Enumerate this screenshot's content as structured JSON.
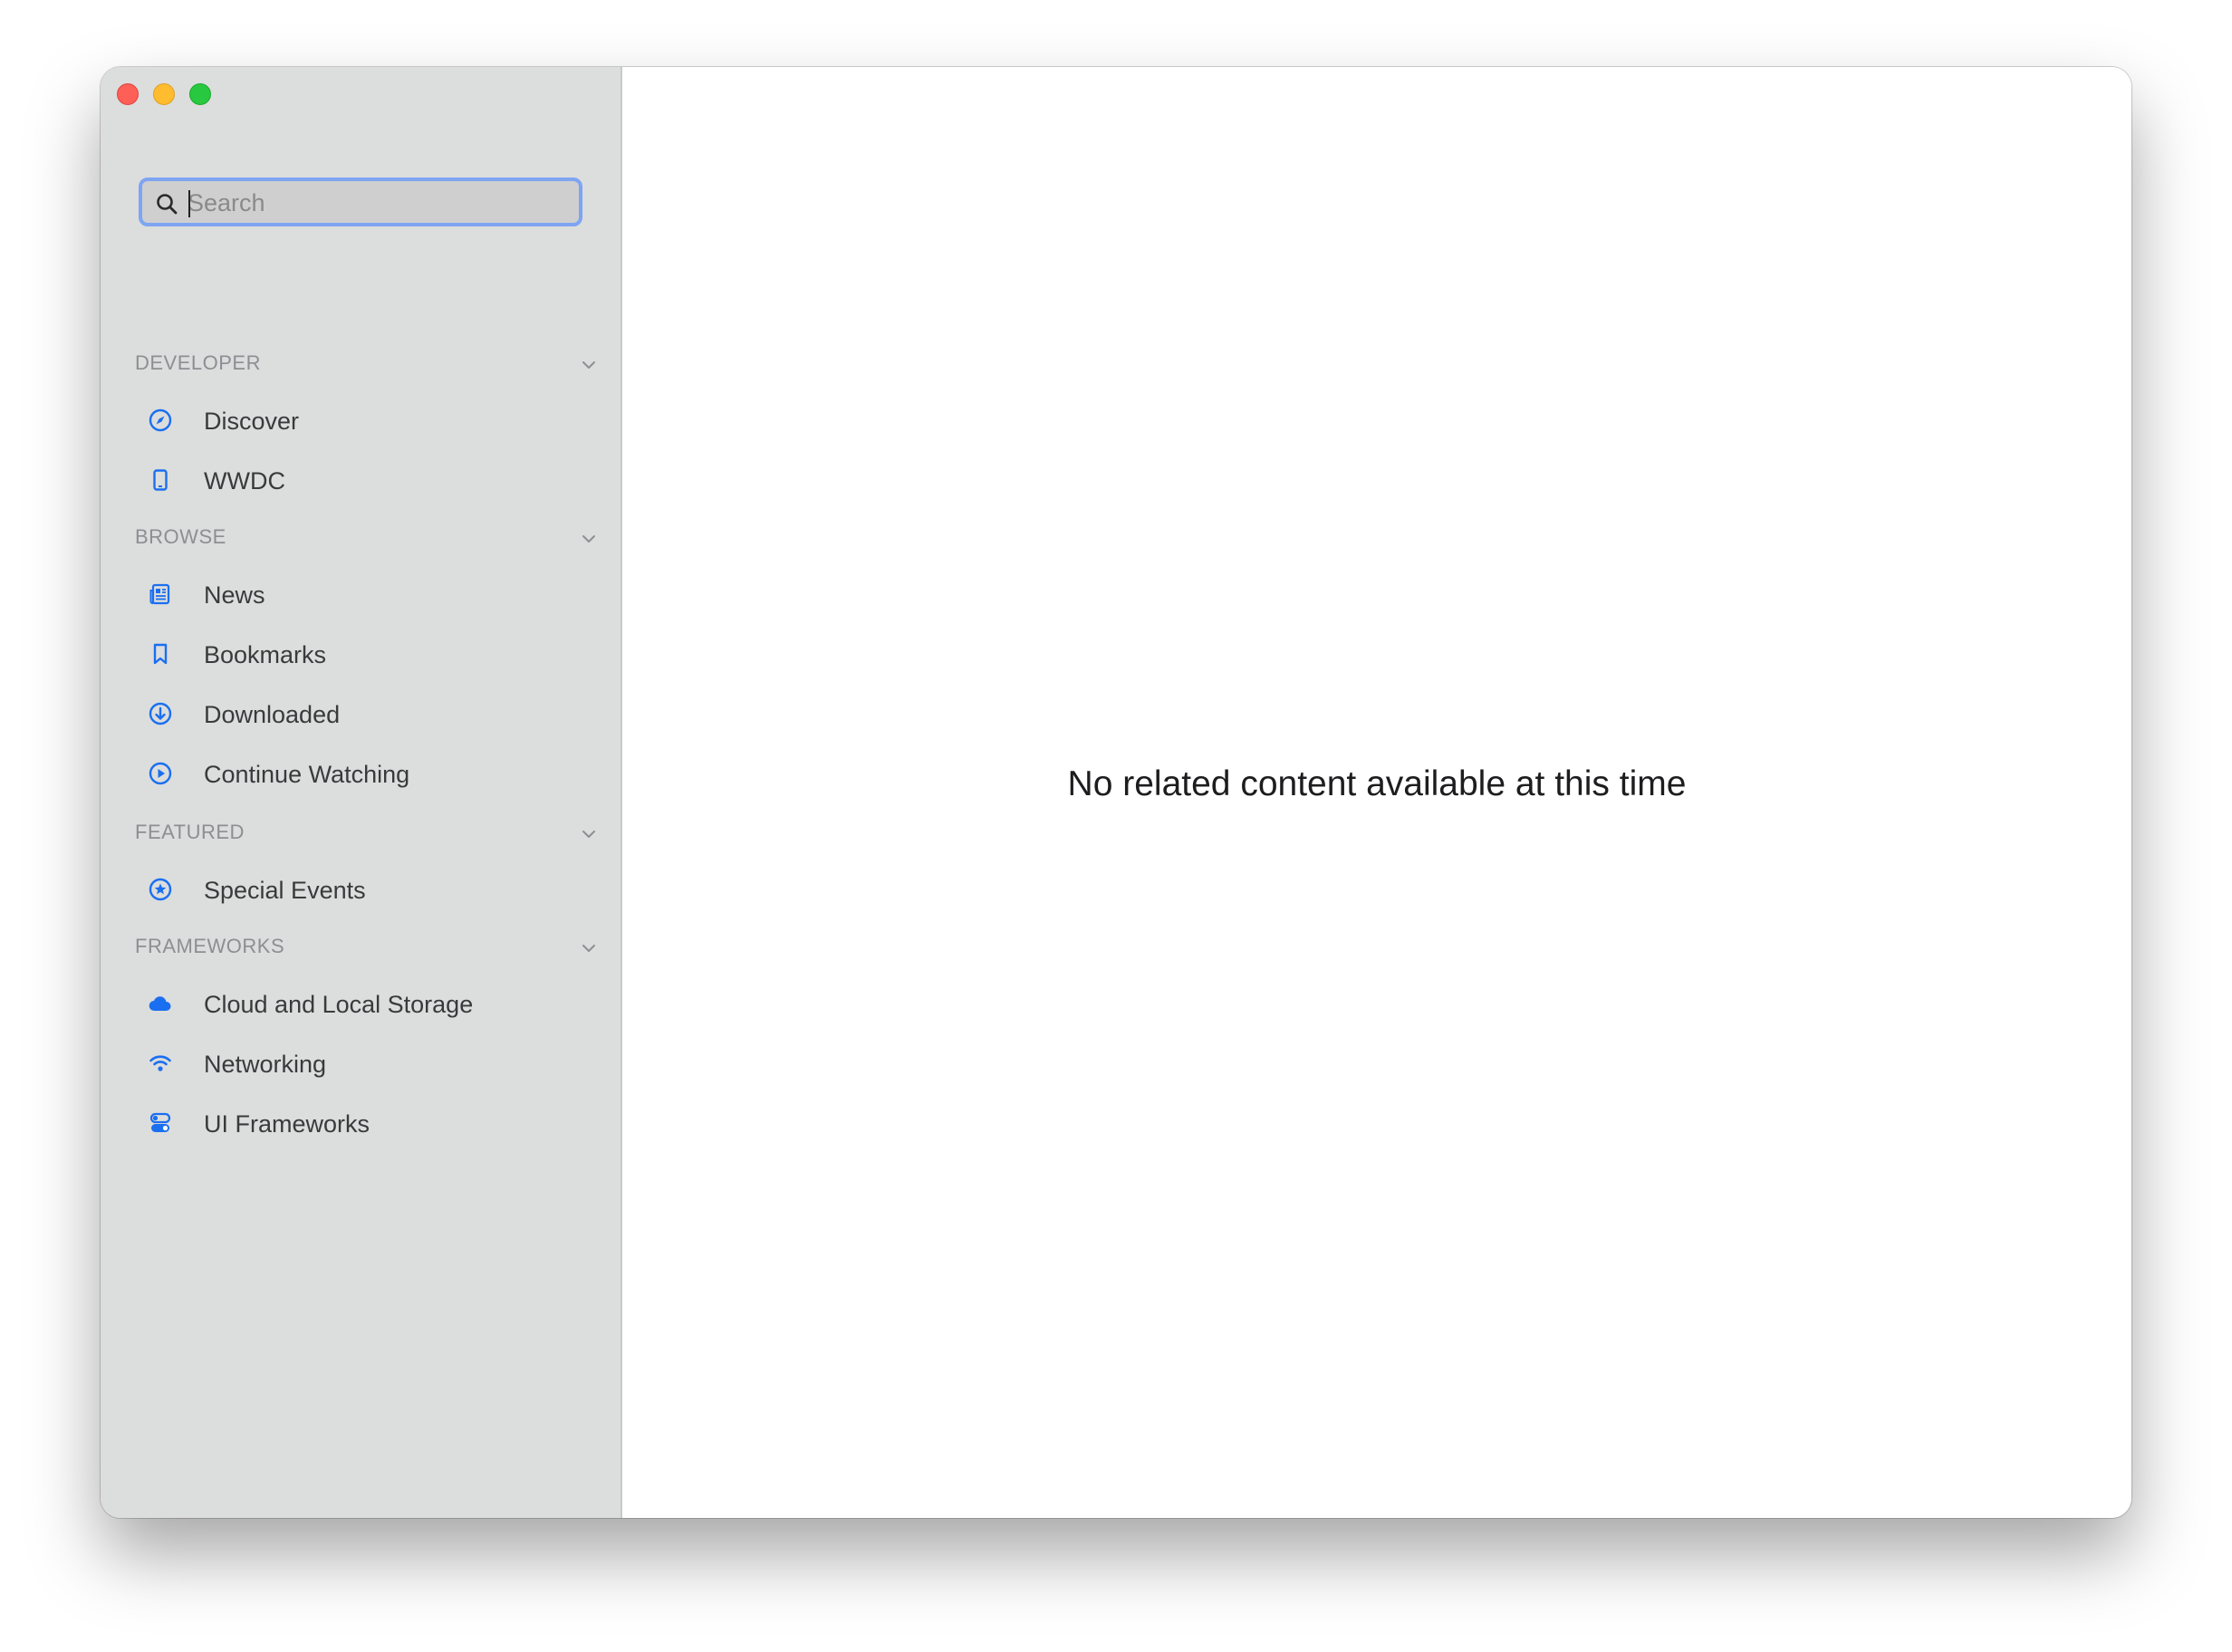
{
  "window": {
    "controls": [
      "close",
      "minimize",
      "zoom"
    ]
  },
  "sidebar": {
    "search": {
      "placeholder": "Search",
      "value": ""
    },
    "sections": [
      {
        "title": "DEVELOPER",
        "items": [
          {
            "label": "Discover",
            "icon": "compass-icon"
          },
          {
            "label": "WWDC",
            "icon": "device-icon"
          }
        ]
      },
      {
        "title": "BROWSE",
        "items": [
          {
            "label": "News",
            "icon": "newspaper-icon"
          },
          {
            "label": "Bookmarks",
            "icon": "bookmark-icon"
          },
          {
            "label": "Downloaded",
            "icon": "download-icon"
          },
          {
            "label": "Continue Watching",
            "icon": "play-circle-icon"
          }
        ]
      },
      {
        "title": "FEATURED",
        "items": [
          {
            "label": "Special Events",
            "icon": "star-circle-icon"
          }
        ]
      },
      {
        "title": "FRAMEWORKS",
        "items": [
          {
            "label": "Cloud and Local Storage",
            "icon": "cloud-icon"
          },
          {
            "label": "Networking",
            "icon": "wifi-icon"
          },
          {
            "label": "UI Frameworks",
            "icon": "toggles-icon"
          }
        ]
      }
    ]
  },
  "main": {
    "empty_message": "No related content available at this time"
  },
  "colors": {
    "accent": "#1a6ff0",
    "sidebar_bg": "#dcdddd",
    "section_title": "#8e8e93"
  }
}
